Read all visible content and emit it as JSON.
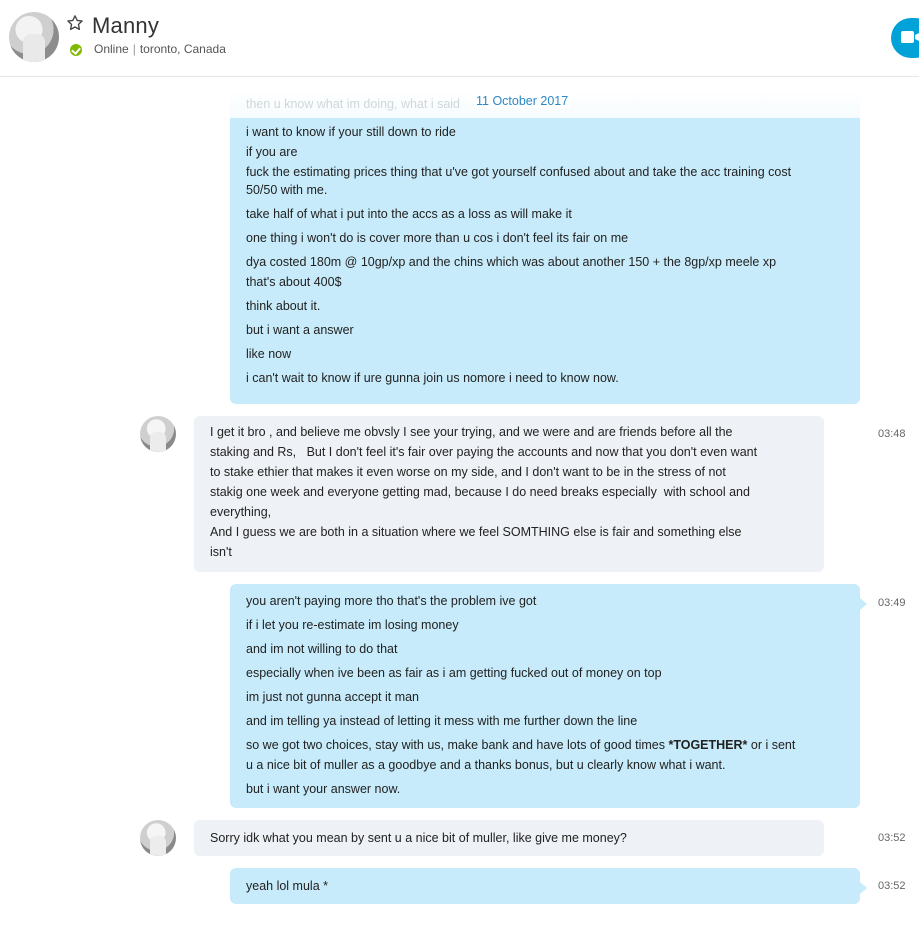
{
  "header": {
    "contact_name": "Manny",
    "status": "Online",
    "location": "toronto, Canada",
    "icons": [
      "star-icon",
      "online-check-icon",
      "video-call-icon"
    ]
  },
  "divider": {
    "ghost_text": "then u know what im doing, what i said",
    "date": "11 October 2017"
  },
  "messages": [
    {
      "id": "m1",
      "direction": "out",
      "lines": [
        "i want to know if your still down to ride",
        "if you are",
        "fuck the estimating prices thing that u've got yourself confused about and take the acc training cost",
        "50/50 with me.",
        "take half of what i put into the accs as a loss as will make it",
        "one thing i won't do is cover more than u cos i don't feel its fair on me",
        "dya costed 180m @ 10gp/xp and the chins which was about another 150 + the 8gp/xp meele xp",
        "that's about 400$",
        "think about it.",
        "but i want a answer",
        "like now",
        "i can't wait to know if ure gunna join us nomore i need to know now."
      ]
    },
    {
      "id": "m2",
      "direction": "in",
      "time": "03:48",
      "lines": [
        "I get it bro , and believe me obvsly I see your trying, and we were and are friends before all the",
        "staking and Rs,   But I don't feel it's fair over paying the accounts and now that you don't even want",
        "to stake ethier that makes it even worse on my side, and I don't want to be in the stress of not",
        "stakig one week and everyone getting mad, because I do need breaks especially  with school and",
        "everything,",
        "And I guess we are both in a situation where we feel SOMTHING else is fair and something else",
        "isn't"
      ]
    },
    {
      "id": "m3",
      "direction": "out",
      "time": "03:49",
      "lines": [
        "you aren't paying more tho that's the problem ive got",
        "if i let you re-estimate im losing money",
        "and im not willing to do that",
        "especially when ive been as fair as i am getting fucked out of money on top",
        "im just not gunna accept it man",
        "and im telling ya instead of letting it mess with me further down the line"
      ],
      "rich_line_before": "so we got two choices, stay with us, make bank and have lots of good times ",
      "rich_line_bold": "*TOGETHER*",
      "rich_line_after": " or i sent",
      "lines_after": [
        "u a nice bit of muller as a goodbye and a thanks bonus, but u clearly know what i want.",
        "but i want your answer now."
      ]
    },
    {
      "id": "m4",
      "direction": "in",
      "time": "03:52",
      "lines": [
        "Sorry idk what you mean by sent u a nice bit of muller, like give me money?"
      ]
    },
    {
      "id": "m5",
      "direction": "out",
      "time": "03:52",
      "lines": [
        "yeah lol mula *"
      ]
    }
  ]
}
